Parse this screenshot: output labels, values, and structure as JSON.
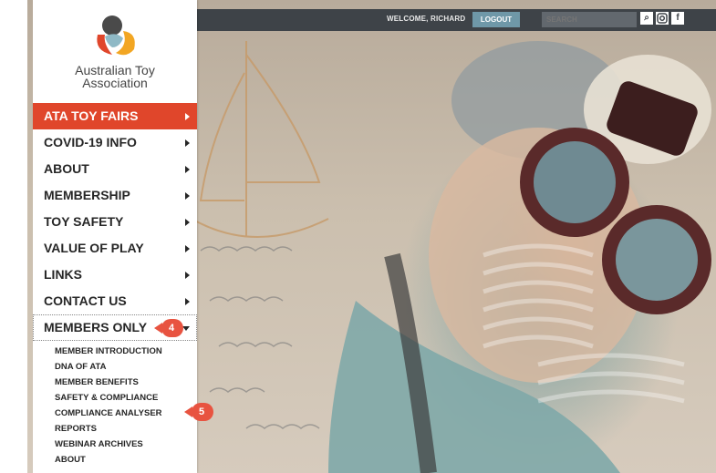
{
  "org": {
    "name_line1": "Australian Toy",
    "name_line2": "Association"
  },
  "topbar": {
    "welcome": "WELCOME, RICHARD",
    "logout_label": "LOGOUT",
    "search_placeholder": "SEARCH",
    "icons": [
      "search-icon",
      "instagram-icon",
      "facebook-icon"
    ]
  },
  "nav": {
    "items": [
      {
        "label": "ATA TOY FAIRS"
      },
      {
        "label": "COVID-19 INFO"
      },
      {
        "label": "ABOUT"
      },
      {
        "label": "MEMBERSHIP"
      },
      {
        "label": "TOY SAFETY"
      },
      {
        "label": "VALUE OF PLAY"
      },
      {
        "label": "LINKS"
      },
      {
        "label": "CONTACT US"
      },
      {
        "label": "MEMBERS ONLY"
      }
    ],
    "submenu": [
      "MEMBER INTRODUCTION",
      "DNA OF ATA",
      "MEMBER BENEFITS",
      "SAFETY & COMPLIANCE",
      "COMPLIANCE ANALYSER",
      "REPORTS",
      "WEBINAR ARCHIVES",
      "ABOUT"
    ]
  },
  "callouts": {
    "step4": "4",
    "step5": "5"
  },
  "colors": {
    "accent": "#e0462b",
    "topbar": "#3e4348",
    "logout": "#6f98a8"
  }
}
